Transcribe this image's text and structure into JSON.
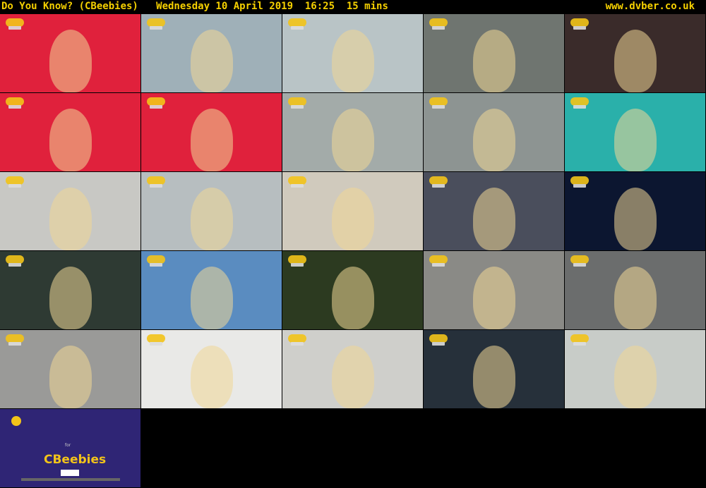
{
  "header": {
    "title": "Do You Know? (CBeebies)   Wednesday 10 April 2019  16:25  15 mins",
    "site": "www.dvber.co.uk"
  },
  "thumbnails": [
    {
      "scene": "remote-control",
      "bg": "#e0213c"
    },
    {
      "scene": "presenter-lift-shaft",
      "bg": "#9fb0b8"
    },
    {
      "scene": "presenter-lift",
      "bg": "#b9c4c6"
    },
    {
      "scene": "presenter-lift-door",
      "bg": "#6f7570"
    },
    {
      "scene": "red-dot-display",
      "bg": "#3a2b2a"
    },
    {
      "scene": "lift-diagram",
      "bg": "#e0213c"
    },
    {
      "scene": "lift-diagram-arrow",
      "bg": "#e0213c"
    },
    {
      "scene": "presenter-hard-hat-lift",
      "bg": "#a3aba9"
    },
    {
      "scene": "lift-shaft-view",
      "bg": "#8d9492"
    },
    {
      "scene": "presenter-waving-teal-frame",
      "bg": "#2ab0aa"
    },
    {
      "scene": "presenter-hard-hat-worker",
      "bg": "#c8c8c4"
    },
    {
      "scene": "presenter-hard-hat-worker-2",
      "bg": "#b7bec0"
    },
    {
      "scene": "vehicle-collage",
      "bg": "#d0cabd"
    },
    {
      "scene": "presenter-space-exhibit",
      "bg": "#4a4e5c"
    },
    {
      "scene": "space-stars",
      "bg": "#0c1630"
    },
    {
      "scene": "presenter-spacesuit-exhibit",
      "bg": "#2e3a33"
    },
    {
      "scene": "presenter-closeup-sky",
      "bg": "#5a8cc0"
    },
    {
      "scene": "foil-pouch",
      "bg": "#2c3a20"
    },
    {
      "scene": "foil-pouch-hands",
      "bg": "#8a8a86"
    },
    {
      "scene": "thermal-camera-airlock",
      "bg": "#6b6d6d"
    },
    {
      "scene": "presenter-foil-pouch",
      "bg": "#9a9a98"
    },
    {
      "scene": "spacesuit-closeup",
      "bg": "#e9e9e7"
    },
    {
      "scene": "white-blur",
      "bg": "#cfcfcb"
    },
    {
      "scene": "presenter-helmet",
      "bg": "#26303a"
    },
    {
      "scene": "presenter-spacesuit-rocket",
      "bg": "#c8ccc8"
    },
    {
      "scene": "cbeebies-endcard",
      "bg": "#2f2575"
    }
  ],
  "endcard": {
    "brand": "CBeebies",
    "for": "for"
  }
}
